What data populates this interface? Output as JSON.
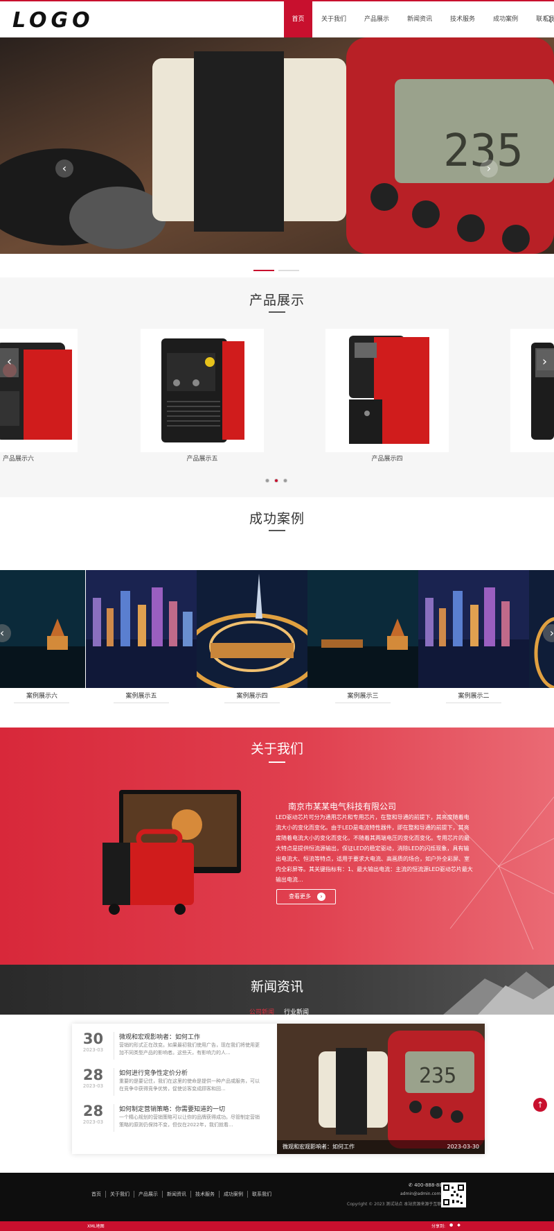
{
  "header": {
    "logo": "LOGO",
    "nav": [
      "首页",
      "关于我们",
      "产品展示",
      "新闻资讯",
      "技术服务",
      "成功案例",
      "联系我们"
    ]
  },
  "hero": {
    "prev": "‹",
    "next": "›"
  },
  "products": {
    "title": "产品展示",
    "items": [
      "产品展示六",
      "产品展示五",
      "产品展示四"
    ],
    "prev": "‹",
    "next": "›"
  },
  "cases": {
    "title": "成功案例",
    "items": [
      "案例展示六",
      "案例展示五",
      "案例展示四",
      "案例展示三",
      "案例展示二"
    ]
  },
  "about": {
    "title": "关于我们",
    "company": "南京市某某电气科技有限公司",
    "text": "LED驱动芯片可分为通用芯片和专用芯片，在整和导通的前提下，其亮度随着电流大小的变化而变化。由于LED是电流特性器件，即在整和导通的前提下，其亮度随着电流大小的变化而变化，不随着其两端电压的变化而变化。专用芯片的最大特点是提供恒流源输出，保证LED的稳定驱动，消除LED的闪烁现象，具有输出电流大、恒流等特点，适用于要求大电流、高画质的场合，如户外全彩屏、室内全彩屏等。其关键指标有：1、最大输出电流：主流的恒流源LED驱动芯片最大输出电流...",
    "more": "查看更多",
    "more_arrow": "›"
  },
  "news": {
    "title": "新闻资讯",
    "tabs": [
      "公司新闻",
      "行业新闻"
    ],
    "items": [
      {
        "day": "30",
        "month": "2023-03",
        "title": "微观和宏观影响者：如何工作",
        "desc": "营销的形式正在改变。如果最初我们使用广告，现在我们将使用更加不同类型产品的影响者。这些天，有影响力的人..."
      },
      {
        "day": "28",
        "month": "2023-03",
        "title": "如何进行竞争性定价分析",
        "desc": "重要的是要记住，我们在这里的使命是提供一种产品或服务，可以在竞争中获得竞争优势，促使访客变成顾客和回..."
      },
      {
        "day": "28",
        "month": "2023-03",
        "title": "如何制定营销策略：你需要知道的一切",
        "desc": "一个精心规划的营销策略可以让你的品牌获得成功。尽管制定营销策略的原则仍保持不变，但仅在2022年，我们就看..."
      }
    ],
    "featured_caption": "微观和宏观影响者：如何工作",
    "featured_date": "2023-03-30"
  },
  "footer": {
    "nav": [
      "首页",
      "关于我们",
      "产品展示",
      "新闻资讯",
      "技术服务",
      "成功案例",
      "联系我们"
    ],
    "phone": "400-888-8888",
    "email": "admin@admin.com",
    "copyright": "Copyright © 2023 测试站点 本站资源来源于互联网",
    "xml": "XML地图",
    "share": "分享到:"
  },
  "colors": {
    "accent": "#c8102e",
    "dark": "#0e0e0e"
  }
}
